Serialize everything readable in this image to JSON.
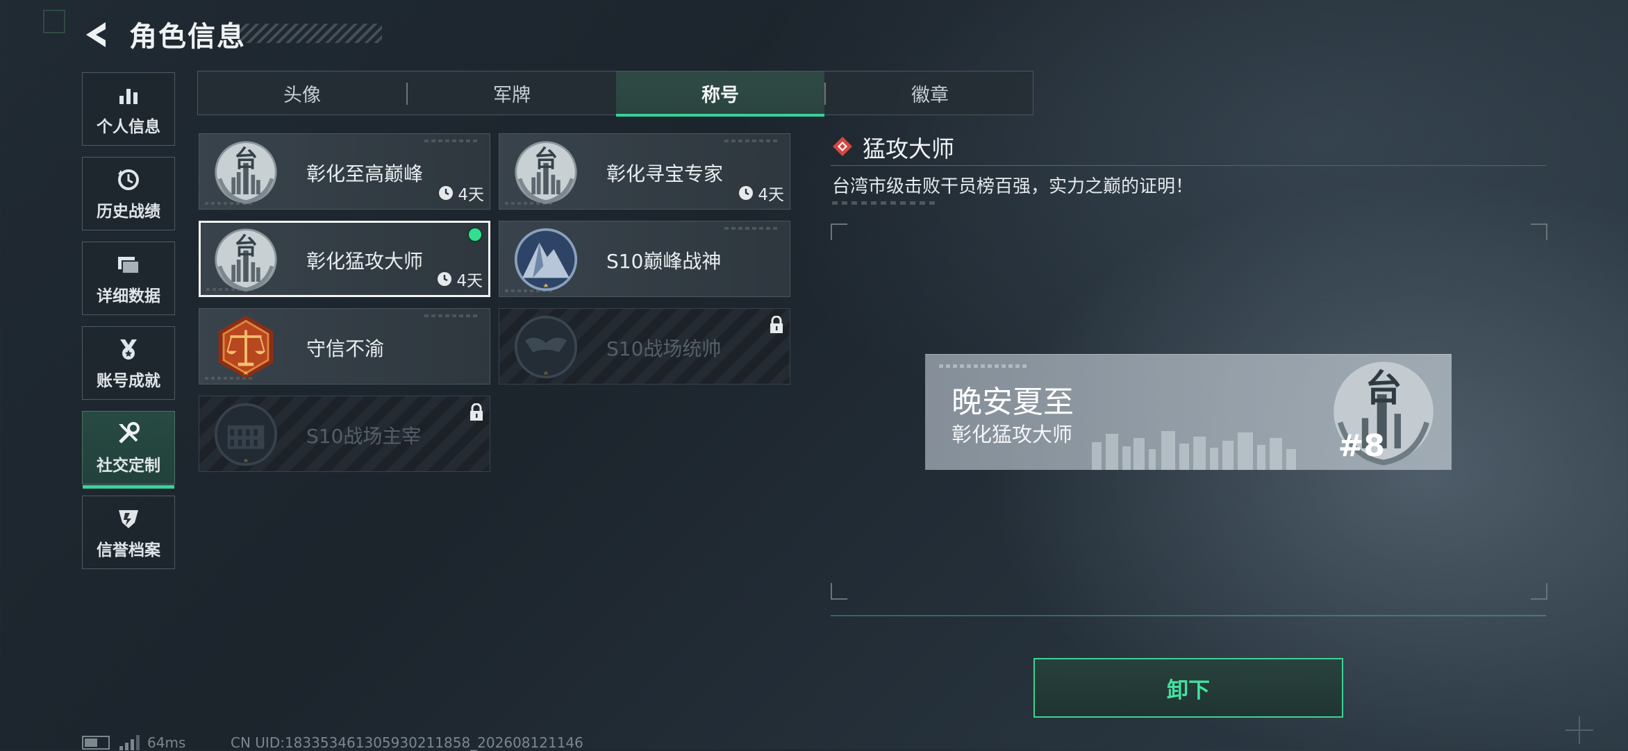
{
  "header": {
    "title": "角色信息"
  },
  "nav": [
    {
      "label": "个人信息",
      "icon": "bar-chart-icon"
    },
    {
      "label": "历史战绩",
      "icon": "history-clock-icon"
    },
    {
      "label": "详细数据",
      "icon": "folders-icon"
    },
    {
      "label": "账号成就",
      "icon": "medal-icon"
    },
    {
      "label": "社交定制",
      "icon": "tools-icon",
      "active": true
    },
    {
      "label": "信誉档案",
      "icon": "shield-badge-icon"
    }
  ],
  "tabs": [
    {
      "label": "头像"
    },
    {
      "label": "军牌"
    },
    {
      "label": "称号",
      "active": true
    },
    {
      "label": "徽章"
    }
  ],
  "cards": [
    {
      "name": "彰化至高巅峰",
      "timer": "4天",
      "icon": "taiwan-emblem-icon"
    },
    {
      "name": "彰化寻宝专家",
      "timer": "4天",
      "icon": "taiwan-emblem-icon"
    },
    {
      "name": "彰化猛攻大师",
      "timer": "4天",
      "icon": "taiwan-emblem-icon",
      "selected": true,
      "equipped": true
    },
    {
      "name": "S10巅峰战神",
      "icon": "mountain-emblem-icon"
    },
    {
      "name": "守信不渝",
      "icon": "scales-emblem-icon"
    },
    {
      "name": "S10战场统帅",
      "icon": "dragon-emblem-icon",
      "locked": true
    },
    {
      "name": "S10战场主宰",
      "icon": "colosseum-emblem-icon",
      "locked": true
    }
  ],
  "detail": {
    "title": "猛攻大师",
    "description": "台湾市级击败干员榜百强，实力之巅的证明！"
  },
  "preview": {
    "player_name": "晚安夏至",
    "title": "彰化猛攻大师",
    "emblem_char": "台",
    "rank": "#8"
  },
  "action": {
    "label": "卸下"
  },
  "status": {
    "ping": "64ms",
    "uid": "CN UID:18335346130593021185​8_202608121146"
  },
  "colors": {
    "accent": "#36d39a",
    "equipped_dot": "#2fe08f"
  }
}
